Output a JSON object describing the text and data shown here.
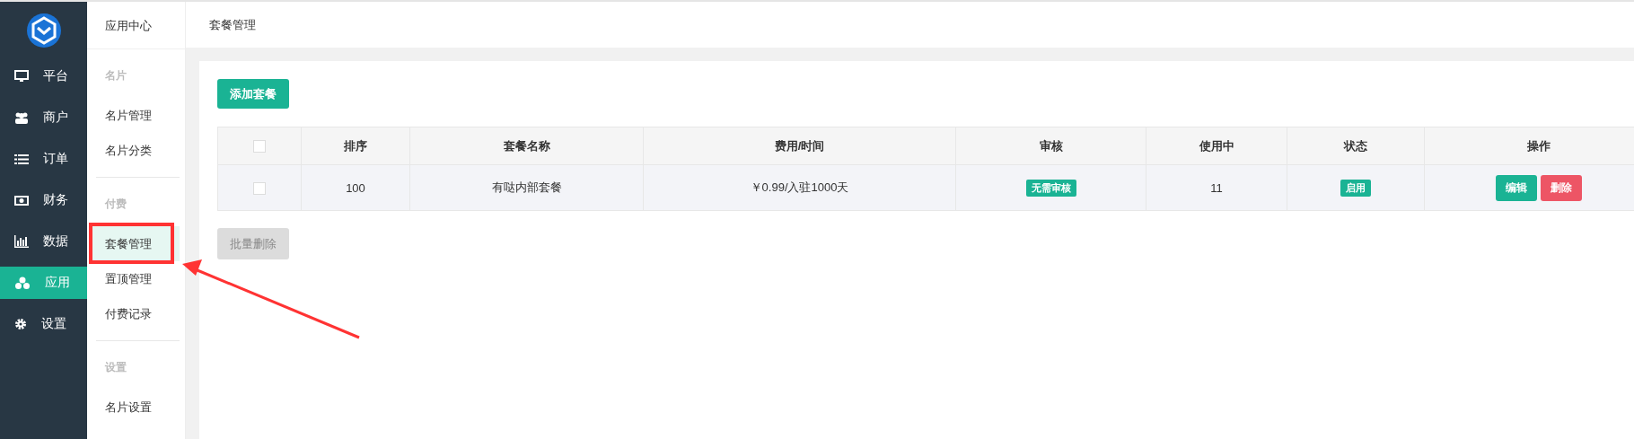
{
  "nav": {
    "items": [
      {
        "label": "平台",
        "selected": false
      },
      {
        "label": "商户",
        "selected": false
      },
      {
        "label": "订单",
        "selected": false
      },
      {
        "label": "财务",
        "selected": false
      },
      {
        "label": "数据",
        "selected": false
      },
      {
        "label": "应用",
        "selected": true
      },
      {
        "label": "设置",
        "selected": false
      }
    ]
  },
  "submenu": {
    "title": "应用中心",
    "groups": [
      {
        "heading": "名片",
        "items": [
          {
            "label": "名片管理",
            "selected": false,
            "annotated": false
          },
          {
            "label": "名片分类",
            "selected": false,
            "annotated": false
          }
        ]
      },
      {
        "heading": "付费",
        "items": [
          {
            "label": "套餐管理",
            "selected": true,
            "annotated": true
          },
          {
            "label": "置顶管理",
            "selected": false,
            "annotated": false
          },
          {
            "label": "付费记录",
            "selected": false,
            "annotated": false
          }
        ]
      },
      {
        "heading": "设置",
        "items": [
          {
            "label": "名片设置",
            "selected": false,
            "annotated": false
          }
        ]
      }
    ]
  },
  "breadcrumb": "套餐管理",
  "add_button": "添加套餐",
  "table": {
    "select_all": {
      "checked": false
    },
    "columns": [
      "排序",
      "套餐名称",
      "费用/时间",
      "审核",
      "使用中",
      "状态",
      "操作"
    ],
    "rows": [
      {
        "checked": false,
        "order": "100",
        "name": "有哒内部套餐",
        "price": "￥0.99/入驻1000天",
        "review": "无需审核",
        "in_use": "11",
        "status": "启用",
        "actions": [
          {
            "label": "编辑",
            "kind": "edit"
          },
          {
            "label": "删除",
            "kind": "delete"
          }
        ]
      }
    ]
  },
  "batch_delete": {
    "label": "批量删除",
    "disabled": true
  }
}
